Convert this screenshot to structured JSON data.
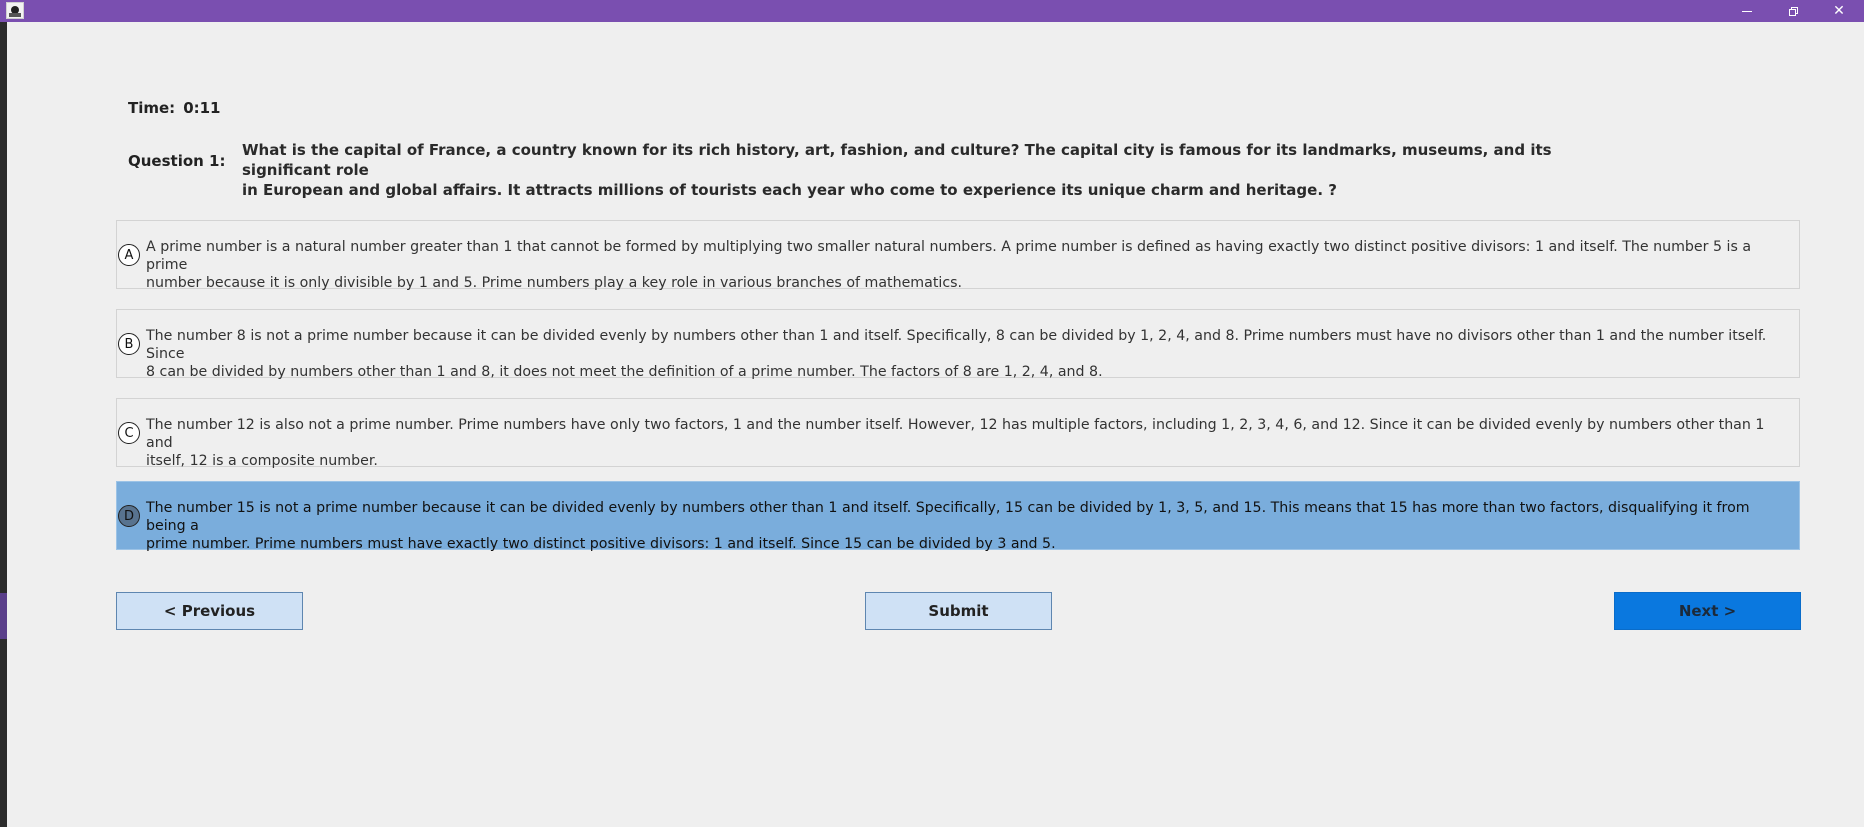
{
  "window": {
    "colors": {
      "titlebar": "#7a4fb0",
      "selected_option": "#7aaddc",
      "next_button": "#0a78df",
      "button": "#cfe1f5"
    }
  },
  "timer": {
    "label": "Time:",
    "value": "0:11"
  },
  "question": {
    "label": "Question 1:",
    "text_line1": "What is the capital of France, a country known for its rich history, art, fashion, and culture? The capital city is famous for its landmarks, museums, and its significant role",
    "text_line2": "in European and global affairs. It attracts millions of tourists each year who come to experience its unique charm and heritage. ?"
  },
  "options": [
    {
      "letter": "A",
      "line1": "A prime number is a natural number greater than 1 that cannot be formed by multiplying two smaller natural numbers. A prime number is defined as having exactly two distinct positive divisors: 1 and itself. The number 5 is a prime",
      "line2": "number because it is only divisible by 1 and 5. Prime numbers play a key role in various branches of mathematics.",
      "selected": false
    },
    {
      "letter": "B",
      "line1": "The number 8 is not a prime number because it can be divided evenly by numbers other than 1 and itself. Specifically, 8 can be divided by 1, 2, 4, and 8. Prime numbers must have no divisors other than 1 and the number itself. Since",
      "line2": "8 can be divided by numbers other than 1 and 8, it does not meet the definition of a prime number. The factors of 8 are 1, 2, 4, and 8.",
      "selected": false
    },
    {
      "letter": "C",
      "line1": "The number 12 is also not a prime number. Prime numbers have only two factors, 1 and the number itself. However, 12 has multiple factors, including 1, 2, 3, 4, 6, and 12. Since it can be divided evenly by numbers other than 1 and",
      "line2": "itself, 12 is a composite number.",
      "selected": false
    },
    {
      "letter": "D",
      "line1": "The number 15 is not a prime number because it can be divided evenly by numbers other than 1 and itself. Specifically, 15 can be divided by 1, 3, 5, and 15. This means that 15 has more than two factors, disqualifying it from being a",
      "line2": "prime number. Prime numbers must have exactly two distinct positive divisors: 1 and itself. Since 15 can be divided by 3 and 5.",
      "selected": true
    }
  ],
  "buttons": {
    "previous": "< Previous",
    "submit": "Submit",
    "next": "Next >"
  }
}
